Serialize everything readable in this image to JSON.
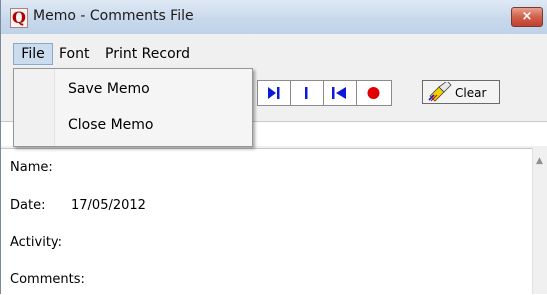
{
  "window": {
    "title": "Memo - Comments File",
    "app_icon": "Q",
    "close_glyph": "×"
  },
  "menubar": {
    "items": [
      "File",
      "Font",
      "Print Record"
    ]
  },
  "file_menu": {
    "items": [
      "Save Memo",
      "Close Memo"
    ]
  },
  "toolbar": {
    "nav_icons": [
      "next-track-icon",
      "skip-end-icon",
      "skip-start-icon",
      "record-icon"
    ],
    "clear_label": "Clear",
    "record_color": "#e00000",
    "nav_color": "#0a1ad8"
  },
  "memo": {
    "name_label": "Name:",
    "date_label": "Date:",
    "date_value": "17/05/2012",
    "activity_label": "Activity:",
    "comments_label": "Comments:"
  }
}
